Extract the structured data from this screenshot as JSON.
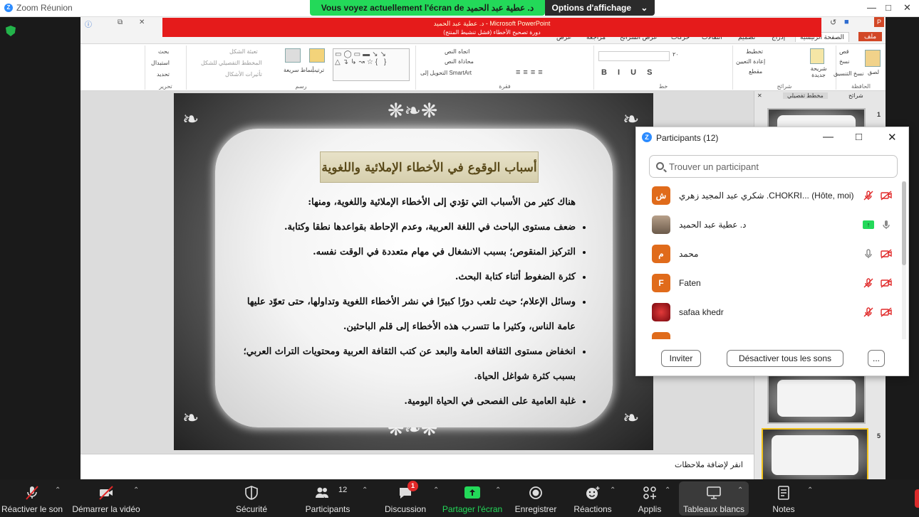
{
  "zoom": {
    "window_title": "Zoom Réunion",
    "share_banner": "Vous voyez actuellement l'écran de د. عطية عبد الحميد",
    "view_options": "Options d'affichage"
  },
  "ppt": {
    "title": "د. عطية عبد الحميد - Microsoft PowerPoint",
    "subtitle": "دورة تصحيح الأخطاء (فشل تنشيط المنتج)",
    "tabs": [
      "ملف",
      "الصفحة الرئيسية",
      "إدراج",
      "تصميم",
      "انتقالات",
      "حركات",
      "عرض الشرائح",
      "مراجعة",
      "عرض"
    ],
    "ribbon_groups": [
      "الحافظة",
      "شرائح",
      "خط",
      "فقرة",
      "رسم",
      "تحرير"
    ],
    "ribbon_items": {
      "paste": "لصق",
      "cut": "قص",
      "copy": "نسخ",
      "format_painter": "نسخ التنسيق",
      "new_slide": "شريحة جديدة",
      "layout": "تخطيط",
      "reset": "إعادة التعيين",
      "section": "مقطع",
      "text_direction": "اتجاه النص",
      "align_text": "محاذاة النص",
      "smartart": "التحويل إلى SmartArt",
      "arrange": "ترتيب",
      "quick_styles": "أنماط سريعة",
      "shape_fill": "تعبئة الشكل",
      "shape_outline": "المخطط التفصيلي للشكل",
      "shape_effects": "تأثيرات الأشكال",
      "find": "بحث",
      "replace": "استبدال",
      "select": "تحديد",
      "font_size": "٢٠"
    },
    "panel_tabs": [
      "شرائح",
      "مخطط تفصيلي"
    ],
    "slide_numbers": [
      "1",
      "5"
    ],
    "notes_placeholder": "انقر لإضافة ملاحظات"
  },
  "slide": {
    "title": "أسباب الوقوع في الأخطاء الإملائية واللغوية",
    "intro": "هناك كثير من الأسباب التي تؤدي إلى الأخطاء الإملائية واللغوية، ومنها:",
    "bullets": [
      "ضعف مستوى الباحث في اللغة العربية، وعدم الإحاطة بقواعدها نطقا وكتابة.",
      "التركيز المنقوص؛ بسبب الانشغال في مهام متعددة في الوقت نفسه.",
      "كثرة الضغوط أثناء كتابة البحث.",
      "وسائل الإعلام؛ حيث تلعب دورًا كبيرًا في نشر الأخطاء اللغوية وتداولها، حتى تعوّد عليها عامة الناس، وكثيرا ما تتسرب هذه الأخطاء إلى قلم الباحثين.",
      "انخفاض مستوى الثقافة العامة والبعد عن كتب الثقافة العربية ومحتويات التراث العربي؛ بسبب كثرة شواغل الحياة.",
      "غلبة العامية على الفصحى في الحياة اليومية."
    ]
  },
  "participants_panel": {
    "title": "Participants (12)",
    "search_placeholder": "Trouver un participant",
    "participants": [
      {
        "initial": "ش",
        "name": "شكري عبد المجيد زهري .CHOKRI... (Hôte, moi)",
        "color": "#e06b1b",
        "mic": "muted",
        "video": "off"
      },
      {
        "initial": "",
        "name": "د. عطية عبد الحميد",
        "color": "#8a7a6a",
        "mic": "on",
        "video": "sharing"
      },
      {
        "initial": "م",
        "name": "محمد",
        "color": "#e06b1b",
        "mic": "on-idle",
        "video": "off"
      },
      {
        "initial": "F",
        "name": "Faten",
        "color": "#e06b1b",
        "mic": "muted",
        "video": "off"
      },
      {
        "initial": "",
        "name": "safaa khedr",
        "color": "#a0141e",
        "mic": "muted",
        "video": "off"
      }
    ],
    "invite_button": "Inviter",
    "mute_all_button": "Désactiver tous les sons",
    "more_button": "..."
  },
  "toolbar": {
    "unmute": "Réactiver le son",
    "start_video": "Démarrer la vidéo",
    "security": "Sécurité",
    "participants": "Participants",
    "participants_count": "12",
    "chat": "Discussion",
    "chat_badge": "1",
    "share": "Partager l'écran",
    "record": "Enregistrer",
    "reactions": "Réactions",
    "apps": "Applis",
    "whiteboards": "Tableaux blancs",
    "notes": "Notes"
  },
  "colors": {
    "zoom_green": "#23d959",
    "zoom_blue": "#2d8cff",
    "ppt_red": "#e51b1b",
    "muted_red": "#e02828"
  }
}
